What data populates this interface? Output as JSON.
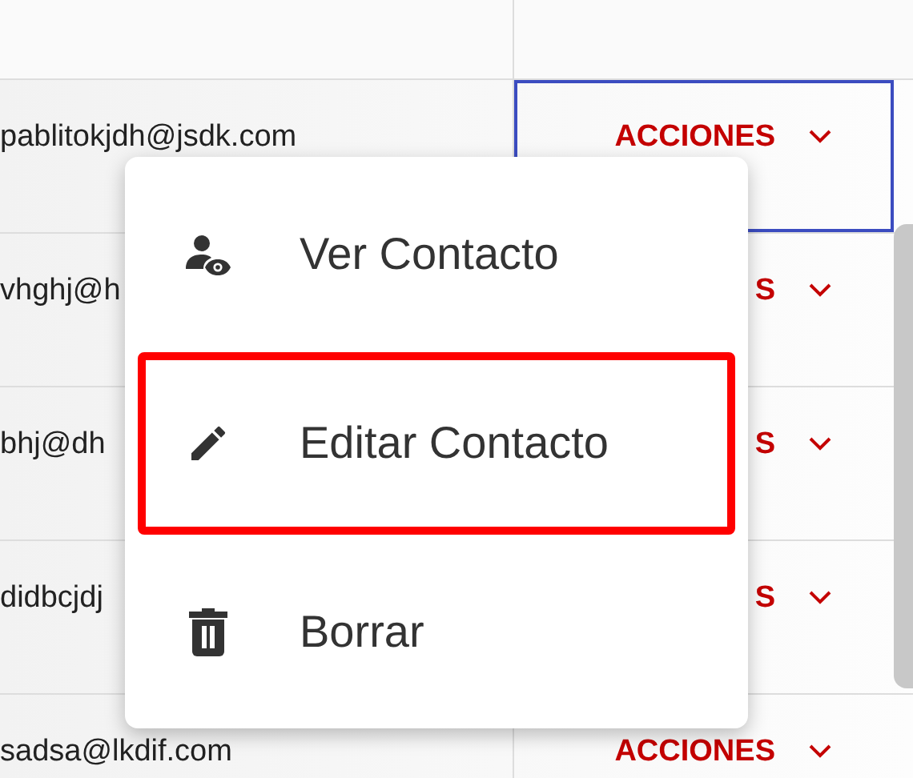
{
  "rows": [
    {
      "email": "pablitokjdh@jsdk.com",
      "action": "ACCIONES",
      "focused": true
    },
    {
      "email": "vhghj@h",
      "action": "S",
      "focused": false
    },
    {
      "email": "bhj@dh",
      "action": "S",
      "focused": false
    },
    {
      "email": "didbcjdj",
      "action": "S",
      "focused": false
    },
    {
      "email": "sadsa@lkdif.com",
      "action": "ACCIONES",
      "focused": false
    }
  ],
  "menu": {
    "items": [
      {
        "kind": "view",
        "label": "Ver Contacto",
        "selected": false
      },
      {
        "kind": "edit",
        "label": "Editar Contacto",
        "selected": true
      },
      {
        "kind": "delete",
        "label": "Borrar",
        "selected": false
      }
    ]
  }
}
